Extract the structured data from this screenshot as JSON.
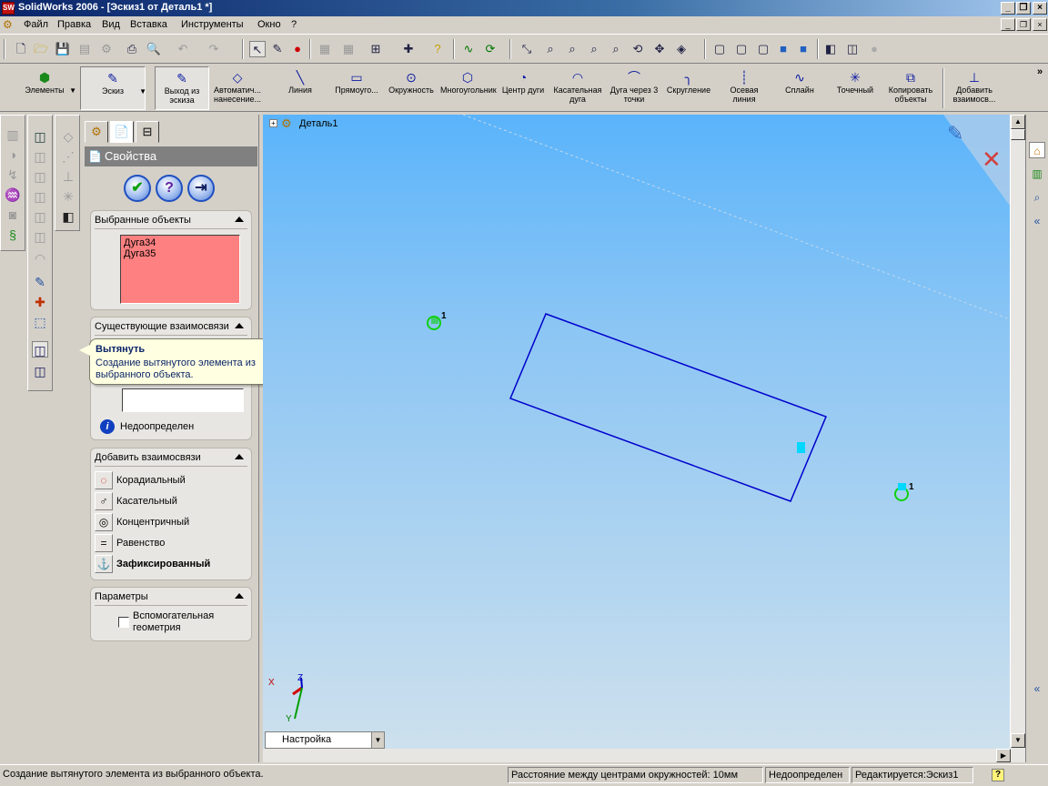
{
  "window": {
    "title": "SolidWorks 2006 - [Эскиз1 от Деталь1 *]",
    "app_icon": "SW"
  },
  "menu": {
    "items": [
      "Файл",
      "Правка",
      "Вид",
      "Вставка",
      "Инструменты",
      "Окно",
      "?"
    ]
  },
  "sketch_toolbar": {
    "items": [
      {
        "label": "Элементы",
        "icon": "features-icon"
      },
      {
        "label": "Эскиз",
        "icon": "sketch-icon"
      },
      {
        "label": "Выход из эскиза",
        "icon": "exit-sketch-icon"
      },
      {
        "label": "Автоматич... нанесение...",
        "icon": "smart-dimension-icon"
      },
      {
        "label": "Линия",
        "icon": "line-icon"
      },
      {
        "label": "Прямоуго...",
        "icon": "rectangle-icon"
      },
      {
        "label": "Окружность",
        "icon": "circle-icon"
      },
      {
        "label": "Многоугольник",
        "icon": "polygon-icon"
      },
      {
        "label": "Центр дуги",
        "icon": "centerpoint-arc-icon"
      },
      {
        "label": "Касательная дуга",
        "icon": "tangent-arc-icon"
      },
      {
        "label": "Дуга через 3 точки",
        "icon": "three-point-arc-icon"
      },
      {
        "label": "Скругление",
        "icon": "fillet-icon"
      },
      {
        "label": "Осевая линия",
        "icon": "centerline-icon"
      },
      {
        "label": "Сплайн",
        "icon": "spline-icon"
      },
      {
        "label": "Точечный",
        "icon": "point-icon"
      },
      {
        "label": "Копировать объекты",
        "icon": "copy-entities-icon"
      },
      {
        "label": "Добавить взаимосв...",
        "icon": "add-relation-icon"
      }
    ],
    "overflow": "»"
  },
  "property_manager": {
    "title": "Свойства",
    "selected": {
      "header": "Выбранные объекты",
      "items": [
        "Дуга34",
        "Дуга35"
      ]
    },
    "existing": {
      "header": "Существующие взаимосвязи",
      "status": "Недоопределен"
    },
    "add_relations": {
      "header": "Добавить взаимосвязи",
      "items": [
        "Корадиальный",
        "Касательный",
        "Концентричный",
        "Равенство",
        "Зафиксированный"
      ]
    },
    "options": {
      "header": "Параметры",
      "checkbox_label": "Вспомогательная геометрия",
      "checked": false
    }
  },
  "tooltip": {
    "title": "Вытянуть",
    "text": "Создание вытянутого элемента из выбранного объекта."
  },
  "viewport": {
    "tree_root": "Деталь1",
    "relation_marker_1": "1",
    "relation_marker_2": "1",
    "axis_x": "X",
    "axis_y": "Y",
    "axis_z": "Z",
    "line_color": "#0000cc",
    "highlight_color": "#00d8ff"
  },
  "configuration": {
    "value": "Настройка"
  },
  "statusbar": {
    "message": "Создание вытянутого элемента из выбранного объекта.",
    "measure": "Расстояние между центрами окружностей:  10мм",
    "state": "Недоопределен",
    "editing": "Редактируется:Эскиз1",
    "help": "?"
  }
}
